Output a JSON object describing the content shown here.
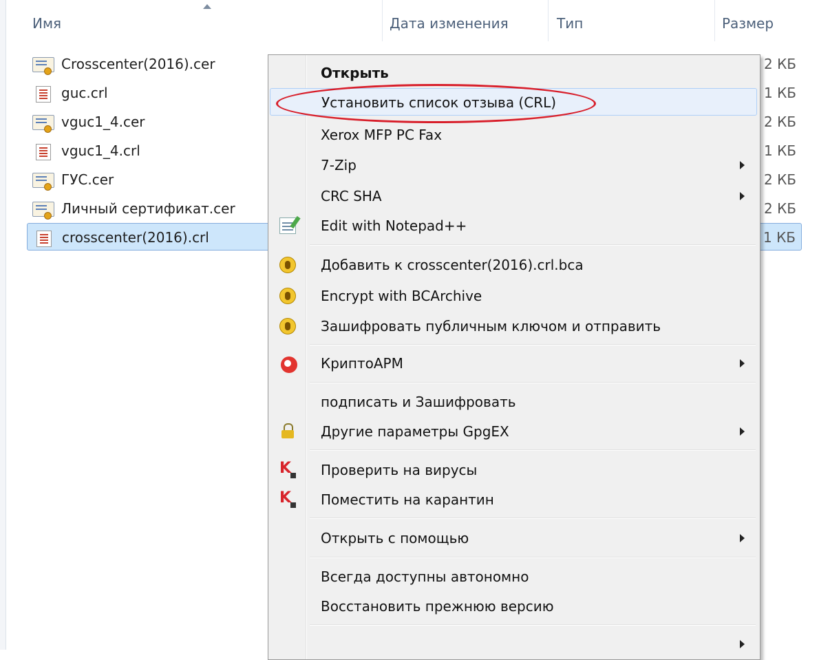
{
  "columns": {
    "name": "Имя",
    "date": "Дата изменения",
    "type": "Тип",
    "size": "Размер"
  },
  "files": [
    {
      "name": "Crosscenter(2016).cer",
      "icon": "certificate-icon",
      "size": "2 КБ"
    },
    {
      "name": "guc.crl",
      "icon": "crl-file-icon",
      "size": "1 КБ"
    },
    {
      "name": "vguc1_4.cer",
      "icon": "certificate-icon",
      "size": "2 КБ"
    },
    {
      "name": "vguc1_4.crl",
      "icon": "crl-file-icon",
      "size": "1 КБ"
    },
    {
      "name": "ГУС.cer",
      "icon": "certificate-icon",
      "size": "2 КБ"
    },
    {
      "name": "Личный сертификат.cer",
      "icon": "certificate-icon",
      "size": "2 КБ"
    },
    {
      "name": "crosscenter(2016).crl",
      "icon": "crl-file-icon",
      "size": "1 КБ",
      "selected": true
    }
  ],
  "menu": {
    "open": "Открыть",
    "install_crl": "Установить список отзыва (CRL)",
    "xerox": "Xerox MFP PC Fax",
    "zip": "7-Zip",
    "crc": "CRC SHA",
    "notepad": "Edit with Notepad++",
    "add_bca": "Добавить к crosscenter(2016).crl.bca",
    "encrypt_bca": "Encrypt with BCArchive",
    "encrypt_send": "Зашифровать публичным ключом и отправить",
    "cryptoarm": "КриптоАРМ",
    "sign_encrypt": "подписать и Зашифровать",
    "gpgex": "Другие параметры GpgEX",
    "scan_virus": "Проверить на вирусы",
    "quarantine": "Поместить на карантин",
    "open_with": "Открыть с помощью",
    "offline": "Всегда доступны автономно",
    "restore": "Восстановить прежнюю версию"
  },
  "colors": {
    "highlight_ellipse": "#d81e2a",
    "selection": "#cde6fb"
  }
}
